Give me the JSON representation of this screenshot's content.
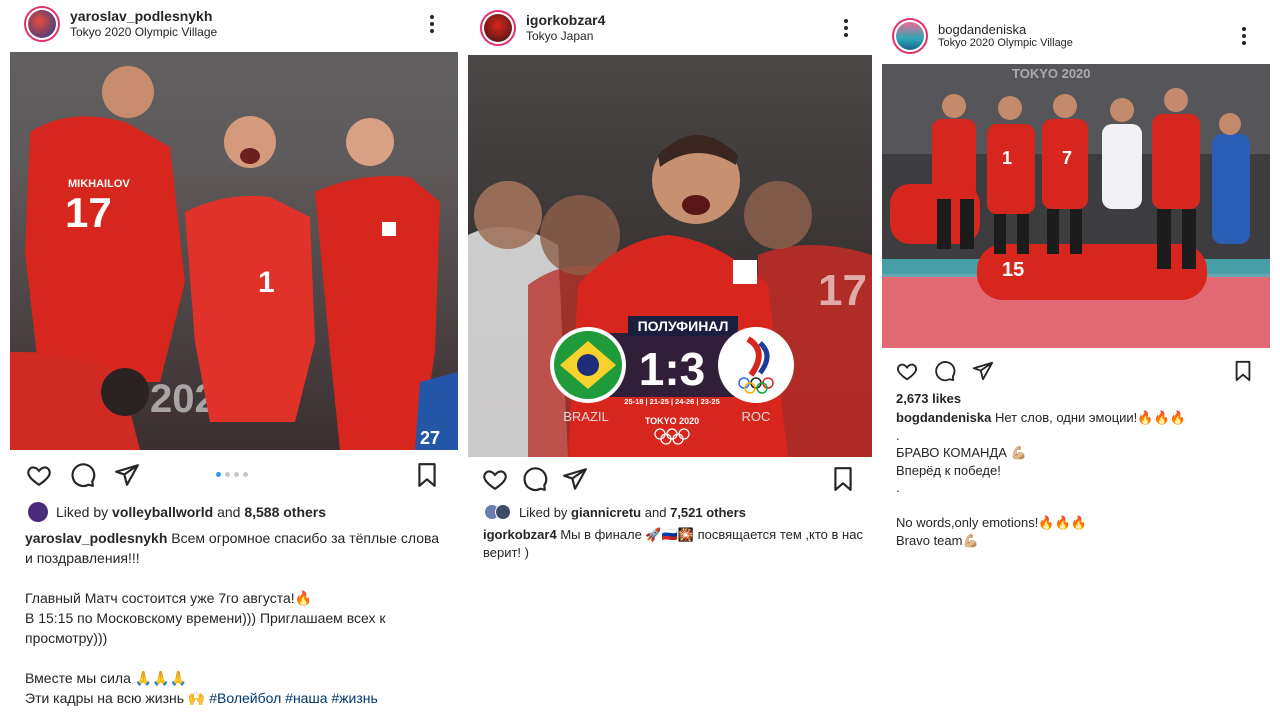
{
  "posts": [
    {
      "username": "yaroslav_podlesnykh",
      "location": "Tokyo 2020 Olympic Village",
      "photo": {
        "jersey_names": [
          "MIKHAILOV"
        ],
        "jersey_numbers": [
          "17",
          "1",
          "27"
        ],
        "backdrop_text": "2020"
      },
      "carousel_dots": 4,
      "carousel_active": 0,
      "liked_by_prefix": "Liked by",
      "liked_by_user": "volleyballworld",
      "liked_by_and": "and",
      "liked_by_others": "8,588 others",
      "caption_user": "yaroslav_podlesnykh",
      "caption_text": "Всем огромное спасибо за тёплые слова и поздравления!!!\n\nГлавный Матч состоится уже 7го августа!🔥\nВ 15:15 по Московскому времени))) Приглашаем всех к просмотру)))\n\nВместе мы сила 🙏🙏🙏\nЭти кадры на всю жизнь 🙌",
      "hashtags": "#Волейбол #наша #жизнь"
    },
    {
      "username": "igorkobzar4",
      "location": "Tokyo Japan",
      "photo": {
        "stage": "ПОЛУФИНАЛ",
        "score": "1:3",
        "sets": "25-18 | 21-25 | 24-26 | 23-25",
        "team_left": "BRAZIL",
        "team_right": "ROC",
        "event": "TOKYO 2020",
        "jersey_numbers": [
          "17"
        ]
      },
      "liked_by_prefix": "Liked by",
      "liked_by_user": "giannicretu",
      "liked_by_and": "and",
      "liked_by_others": "7,521 others",
      "caption_user": "igorkobzar4",
      "caption_text": "Мы в финале 🚀🇷🇺🎇 посвящается тем ,кто в нас верит! )"
    },
    {
      "username": "bogdandeniska",
      "location": "Tokyo 2020 Olympic Village",
      "photo": {
        "backdrop_text": "TOKYO 2020",
        "jersey_numbers": [
          "1",
          "7",
          "15"
        ]
      },
      "likes": "2,673 likes",
      "caption_user": "bogdandeniska",
      "caption_text": "Нет слов, одни эмоции!🔥🔥🔥\n.\nБРАВО КОМАНДА 💪🏼\nВперёд к победе!\n.\n\nNo words,only emotions!🔥🔥🔥\nBravo team💪🏼"
    }
  ],
  "colors": {
    "accent": "#e1306c",
    "text": "#262626",
    "link": "#00376b",
    "jersey_red": "#d7261d"
  }
}
